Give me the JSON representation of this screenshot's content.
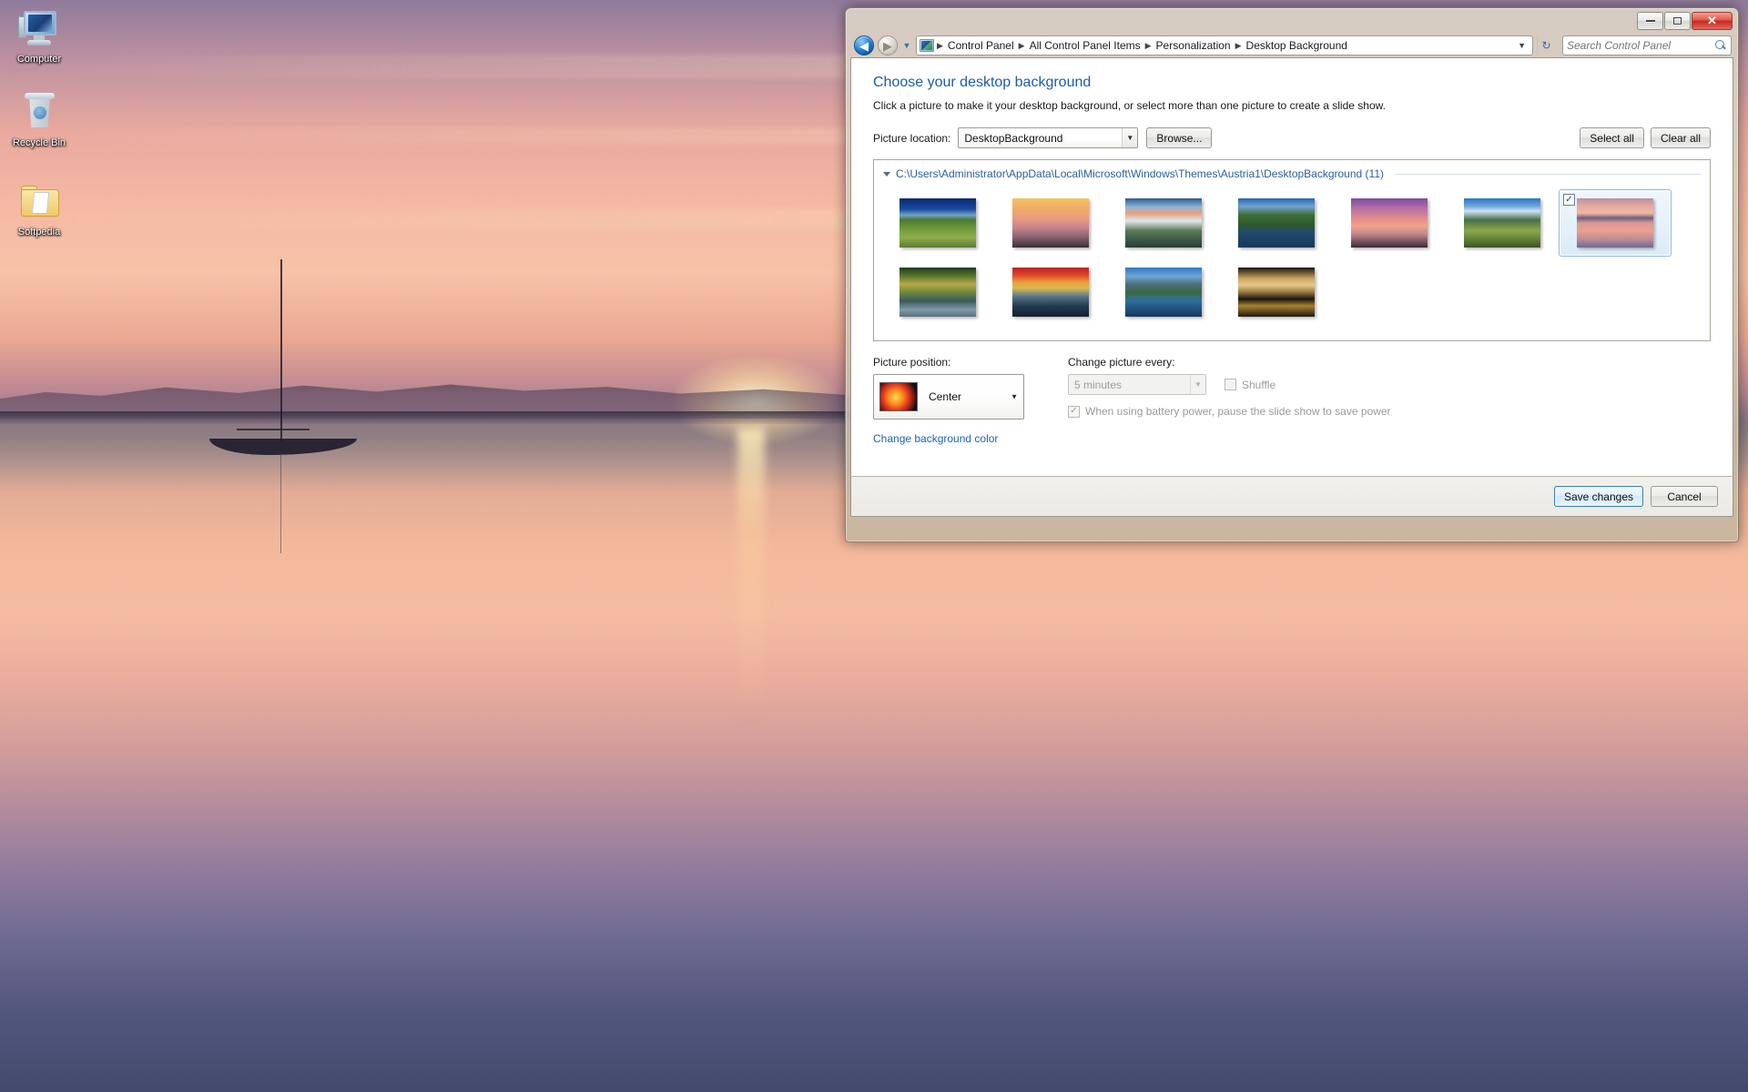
{
  "desktop": {
    "icons": [
      {
        "label": "Computer",
        "icon": "computer-icon"
      },
      {
        "label": "Recycle Bin",
        "icon": "recycle-bin-icon"
      },
      {
        "label": "Softpedia",
        "icon": "folder-icon"
      }
    ]
  },
  "window": {
    "controls": {
      "minimize": "Minimize",
      "maximize": "Maximize",
      "close": "Close"
    },
    "nav": {
      "back": "Back",
      "forward": "Forward",
      "recent_pages": "Recent pages",
      "refresh": "Refresh"
    },
    "breadcrumb": [
      "Control Panel",
      "All Control Panel Items",
      "Personalization",
      "Desktop Background"
    ],
    "search": {
      "placeholder": "Search Control Panel",
      "value": ""
    }
  },
  "page": {
    "heading": "Choose your desktop background",
    "subtitle": "Click a picture to make it your desktop background, or select more than one picture to create a slide show.",
    "picture_location_label": "Picture location:",
    "picture_location_value": "DesktopBackground",
    "browse_label": "Browse...",
    "select_all_label": "Select all",
    "clear_all_label": "Clear all"
  },
  "gallery": {
    "group_path": "C:\\Users\\Administrator\\AppData\\Local\\Microsoft\\Windows\\Themes\\Austria1\\DesktopBackground (11)",
    "count": 11,
    "items": [
      {
        "name": "vineyard-rows",
        "selected": false,
        "css": "linear-gradient(to bottom,#0c2a6e 0%,#1a4aa0 22%,#6fa0c8 34%,#4c7a2e 44%,#6f9a3a 62%,#8fae4c 80%,#5c7a30 100%)"
      },
      {
        "name": "golden-haze-sunset",
        "selected": false,
        "css": "linear-gradient(to bottom,#f2c25f 0%,#f0a96a 24%,#e89682 44%,#c4838c 60%,#8a6572 78%,#3a2e38 100%)"
      },
      {
        "name": "snowy-mountain-range",
        "selected": false,
        "css": "linear-gradient(to bottom,#2c5b93 0%,#8fb6d6 18%,#e8a07a 30%,#dfe6ee 46%,#5a7a55 66%,#3c5a48 84%,#2a3c33 100%)"
      },
      {
        "name": "lakeside-green-hill",
        "selected": false,
        "css": "linear-gradient(to bottom,#2566b4 0%,#6fa2d0 16%,#3f6f34 34%,#2f5a2a 52%,#1f4a6e 70%,#17385a 100%)"
      },
      {
        "name": "lighthouse-pier-dusk",
        "selected": false,
        "css": "linear-gradient(to bottom,#7a4f9c 0%,#b56fa8 20%,#e08a8c 40%,#f0a38a 56%,#c6888c 72%,#3a2a3c 100%)"
      },
      {
        "name": "autumn-valley-blue-sky",
        "selected": false,
        "css": "linear-gradient(to bottom,#2a74c4 0%,#6fa8dc 16%,#cfe2f2 26%,#4a6f4a 44%,#8aa84a 66%,#5c7a34 86%,#3c5228 100%)"
      },
      {
        "name": "calm-lake-sunrise",
        "selected": true,
        "css": "linear-gradient(to bottom,#b98fa0 0%,#e8a99f 16%,#f0b8a4 30%,#6f5f7d 40%,#d79a92 50%,#ee9f8f 66%,#b98a96 84%,#6e6a92 100%)"
      },
      {
        "name": "forest-lake-rocks",
        "selected": false,
        "css": "linear-gradient(to bottom,#1f3a22 0%,#5c7a2a 18%,#b8a84a 34%,#6f8a3c 50%,#3a5a5c 68%,#7f9aa8 86%,#5a7080 100%)"
      },
      {
        "name": "red-sky-pine-lake",
        "selected": false,
        "css": "linear-gradient(to bottom,#b81f1f 0%,#e04a28 16%,#e8a03c 30%,#d9b84c 42%,#5a7a8c 58%,#243a52 78%,#15202e 100%)"
      },
      {
        "name": "alpine-lake-reflection",
        "selected": false,
        "css": "linear-gradient(to bottom,#2d78c2 0%,#6fa6d4 18%,#4a6f7c 34%,#3a6a44 50%,#2f6f9c 68%,#1f4f7c 86%,#17385c 100%)"
      },
      {
        "name": "palace-night-reflection",
        "selected": false,
        "css": "linear-gradient(to bottom,#1a1410 0%,#c9a35c 22%,#e8c98a 36%,#8a6c3c 52%,#1a1612 64%,#a8822f 78%,#20180f 100%)"
      }
    ]
  },
  "options": {
    "picture_position_label": "Picture position:",
    "picture_position_value": "Center",
    "change_picture_every_label": "Change picture every:",
    "change_picture_every_value": "5 minutes",
    "shuffle_label": "Shuffle",
    "shuffle_checked": false,
    "battery_label": "When using battery power, pause the slide show to save power",
    "battery_checked": true,
    "change_background_color_link": "Change background color"
  },
  "footer": {
    "save_label": "Save changes",
    "cancel_label": "Cancel"
  },
  "colors": {
    "heading": "#1c5cab",
    "link": "#1a63b8",
    "selection": "#8cb8dd",
    "close_button": "#c5291c"
  }
}
